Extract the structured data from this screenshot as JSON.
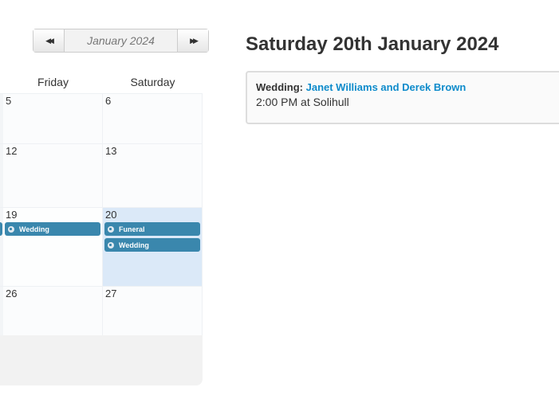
{
  "nav": {
    "prev_icon": "fast-backward-icon",
    "prev_glyph": "◀◀",
    "month_label": "January 2024",
    "next_icon": "fast-forward-icon",
    "next_glyph": "▶▶"
  },
  "calendar": {
    "weekdays": [
      "Friday",
      "Saturday"
    ],
    "weeks": [
      {
        "days": [
          {
            "num": "5",
            "events": []
          },
          {
            "num": "6",
            "events": []
          }
        ]
      },
      {
        "days": [
          {
            "num": "12",
            "events": []
          },
          {
            "num": "13",
            "events": []
          }
        ]
      },
      {
        "days": [
          {
            "num": "19",
            "events": [
              "Wedding"
            ]
          },
          {
            "num": "20",
            "events": [
              "Funeral",
              "Wedding"
            ],
            "today": true
          }
        ]
      },
      {
        "days": [
          {
            "num": "26",
            "events": []
          },
          {
            "num": "27",
            "events": []
          }
        ]
      }
    ],
    "event_color": "#3a87ad",
    "today_color": "#dbe9f8"
  },
  "detail": {
    "title": "Saturday 20th January 2024",
    "event_type": "Wedding:",
    "event_name": "Janet Williams and Derek Brown",
    "event_time_location": "2:00 PM at Solihull"
  }
}
